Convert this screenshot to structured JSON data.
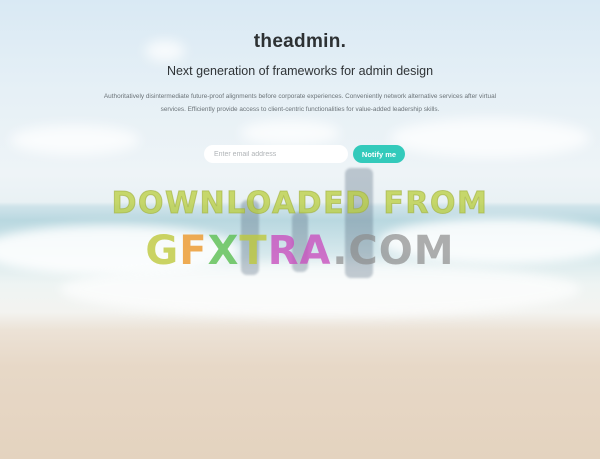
{
  "brand": {
    "name": "theadmin."
  },
  "hero": {
    "tagline": "Next generation of frameworks for admin design",
    "description_line1": "Authoritatively disintermediate future-proof alignments before corporate experiences. Conveniently network alternative services after virtual",
    "description_line2": "services. Efficiently provide access to client-centric functionalities for value-added leadership skills."
  },
  "signup": {
    "email_placeholder": "Enter email address",
    "button_label": "Notify me"
  },
  "watermark": {
    "line1": "DOWNLOADED FROM",
    "line2_parts": [
      "G",
      "F",
      "X",
      "T",
      "RA",
      ".COM"
    ]
  },
  "colors": {
    "accent": "#33cabb",
    "text_dark": "#2d3133",
    "text_muted": "#6b7378"
  }
}
